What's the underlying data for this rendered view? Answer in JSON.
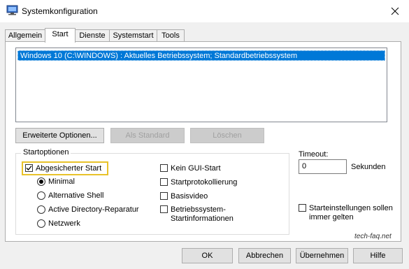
{
  "window": {
    "title": "Systemkonfiguration"
  },
  "tabs": [
    {
      "label": "Allgemein"
    },
    {
      "label": "Start"
    },
    {
      "label": "Dienste"
    },
    {
      "label": "Systemstart"
    },
    {
      "label": "Tools"
    }
  ],
  "active_tab": "Start",
  "os_list": {
    "items": [
      {
        "label": "Windows 10 (C:\\WINDOWS) : Aktuelles Betriebssystem; Standardbetriebssystem",
        "selected": true
      }
    ]
  },
  "list_buttons": {
    "advanced": "Erweiterte Optionen...",
    "set_default": "Als Standard",
    "delete": "Löschen"
  },
  "boot_options": {
    "group_label": "Startoptionen",
    "safe_boot": {
      "label": "Abgesicherter Start",
      "checked": true
    },
    "radios": [
      {
        "label": "Minimal",
        "selected": true
      },
      {
        "label": "Alternative Shell",
        "selected": false
      },
      {
        "label": "Active Directory-Reparatur",
        "selected": false
      },
      {
        "label": "Netzwerk",
        "selected": false
      }
    ],
    "no_gui_boot": {
      "label": "Kein GUI-Start",
      "checked": false
    },
    "boot_log": {
      "label": "Startprotokollierung",
      "checked": false
    },
    "base_video": {
      "label": "Basisvideo",
      "checked": false
    },
    "os_boot_info": {
      "line1": "Betriebssystem-",
      "line2": "Startinformationen",
      "checked": false
    }
  },
  "timeout": {
    "label": "Timeout:",
    "value": "0",
    "unit": "Sekunden"
  },
  "permanent": {
    "line1": "Starteinstellungen sollen",
    "line2": "immer gelten",
    "checked": false
  },
  "watermark": "tech-faq.net",
  "footer_buttons": {
    "ok": "OK",
    "cancel": "Abbrechen",
    "apply": "Übernehmen",
    "help": "Hilfe"
  },
  "colors": {
    "selection": "#0078d7",
    "highlight_border": "#e8c22a",
    "check_mark": "#0078d7"
  }
}
